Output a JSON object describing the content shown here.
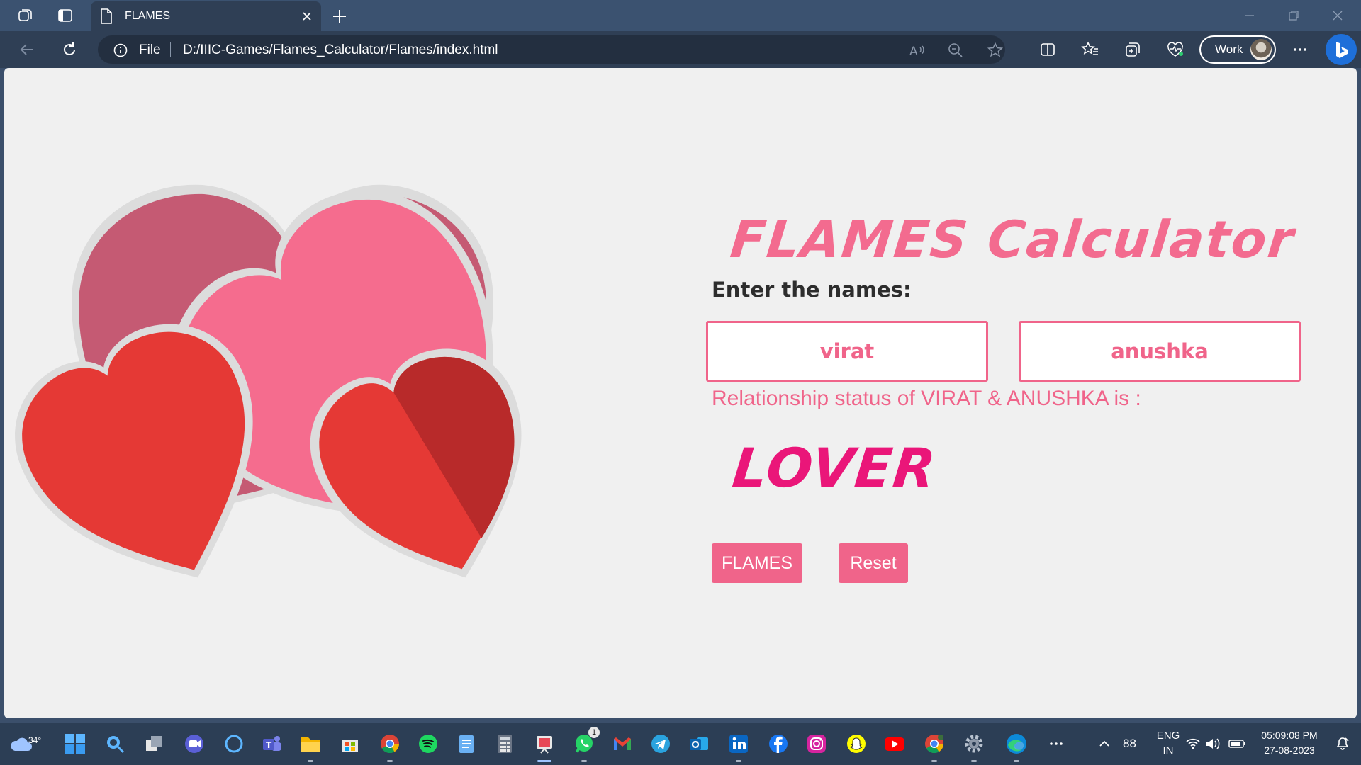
{
  "browser": {
    "tab_title": "FLAMES",
    "address_scheme": "File",
    "url": "D:/IIIC-Games/Flames_Calculator/Flames/index.html",
    "profile_label": "Work"
  },
  "page": {
    "title": "FLAMES Calculator",
    "prompt": "Enter the names:",
    "name1": "virat",
    "name2": "anushka",
    "status_text": "Relationship status of VIRAT & ANUSHKA is :",
    "result": "LOVER",
    "flames_button": "FLAMES",
    "reset_button": "Reset",
    "colors": {
      "accent": "#f0648a",
      "result": "#ea1679",
      "background": "#f0f0f0"
    }
  },
  "taskbar": {
    "weather_temp": "34°",
    "whatsapp_badge": "1",
    "battery_percent": "88",
    "language": "ENG",
    "region": "IN",
    "time": "05:09:08 PM",
    "date": "27-08-2023",
    "apps": [
      "weather-icon",
      "start-icon",
      "search-icon",
      "task-view-icon",
      "meet-icon",
      "cortana-icon",
      "teams-icon",
      "file-explorer-icon",
      "store-icon",
      "chrome-icon",
      "spotify-icon",
      "notepad-icon",
      "calculator-icon",
      "snipping-tool-icon",
      "whatsapp-icon",
      "gmail-icon",
      "telegram-icon",
      "outlook-icon",
      "linkedin-icon",
      "facebook-icon",
      "instagram-icon",
      "snapchat-icon",
      "youtube-icon",
      "chrome-profile-icon",
      "settings-icon",
      "edge-icon",
      "more-apps-icon"
    ]
  }
}
